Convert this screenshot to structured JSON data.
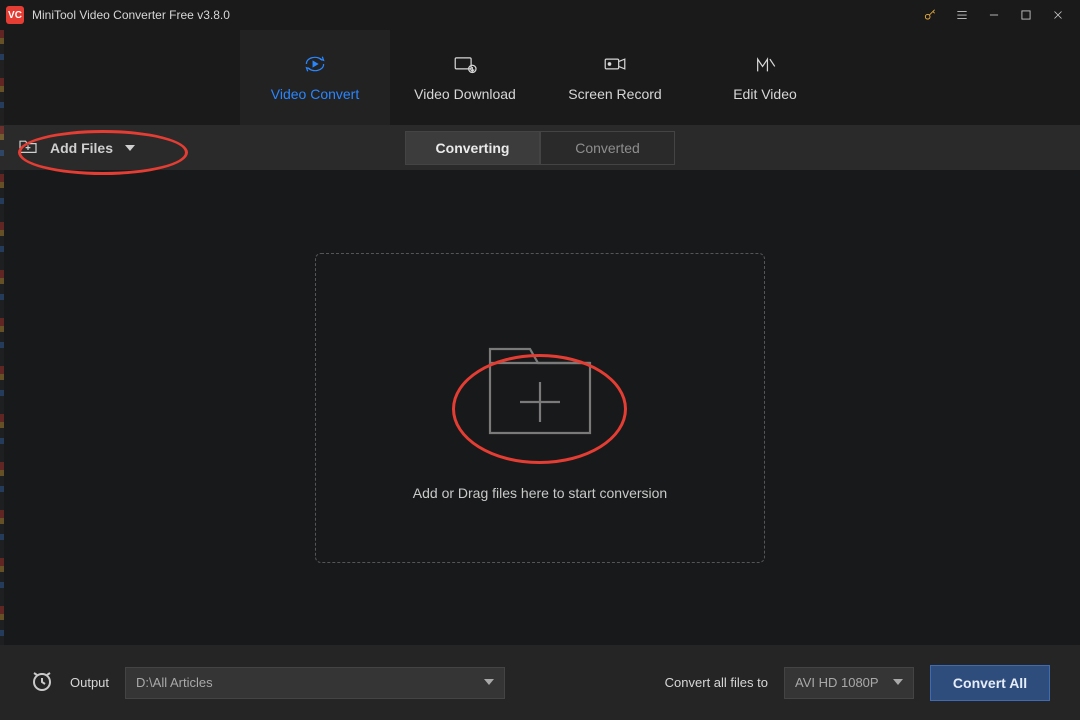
{
  "app": {
    "title": "MiniTool Video Converter Free v3.8.0",
    "logo_text": "VC"
  },
  "titlebar_icons": {
    "key": "key-icon",
    "menu": "menu-icon",
    "minimize": "minimize-icon",
    "maximize": "maximize-icon",
    "close": "close-icon"
  },
  "toptabs": [
    {
      "id": "video-convert",
      "label": "Video Convert",
      "icon": "refresh-play-icon",
      "active": true
    },
    {
      "id": "video-download",
      "label": "Video Download",
      "icon": "download-film-icon",
      "active": false
    },
    {
      "id": "screen-record",
      "label": "Screen Record",
      "icon": "camera-rec-icon",
      "active": false
    },
    {
      "id": "edit-video",
      "label": "Edit Video",
      "icon": "scissors-m-icon",
      "active": false
    }
  ],
  "toolbar": {
    "add_files_label": "Add Files",
    "toggle_converting": "Converting",
    "toggle_converted": "Converted",
    "active_toggle": "converting"
  },
  "dropzone": {
    "text": "Add or Drag files here to start conversion"
  },
  "bottombar": {
    "output_label": "Output",
    "output_path": "D:\\All Articles",
    "convert_all_files_to_label": "Convert all files to",
    "convert_preset": "AVI HD 1080P",
    "convert_all_button": "Convert All"
  },
  "annotations": {
    "comment": "Red ovals drawn on the screenshot highlighting Add Files button and the drop-zone plus icon"
  }
}
